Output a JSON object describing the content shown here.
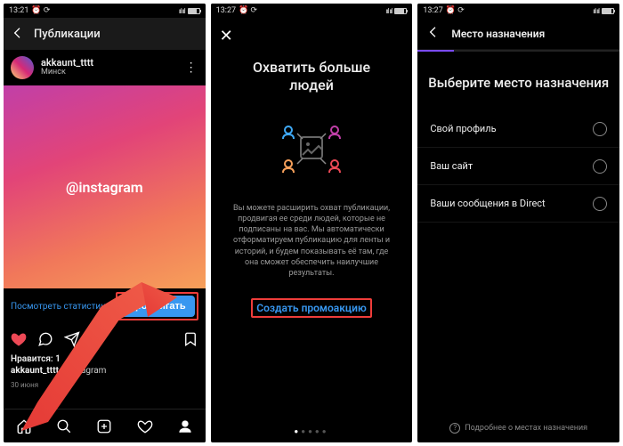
{
  "screen1": {
    "status": {
      "time": "13:21",
      "carrier": "⏰ ⟳",
      "signal": "ııl ııl",
      "batt": "68"
    },
    "header_title": "Публикации",
    "user": {
      "name": "akkaunt_tttt",
      "location": "Минск"
    },
    "image_text": "@instagram",
    "view_stats": "Посмотреть статистику",
    "promote": "Продвигать",
    "likes_line": "Нравится: 1",
    "caption_user": "akkaunt_tttt",
    "caption_hashtag": "#instagram",
    "date": "30 июня"
  },
  "screen2": {
    "status": {
      "time": "13:27",
      "carrier": "⏰ ⟳",
      "signal": "ııl ııl",
      "batt": "68"
    },
    "close": "✕",
    "title_l1": "Охватить больше",
    "title_l2": "людей",
    "desc": "Вы можете расширить охват публикации, продвигая ее среди людей, которые не подписаны на вас. Мы автоматически отформатируем публикацию для ленты и историй, и будем показывать её там, где она сможет обеспечить наилучшие результаты.",
    "cta": "Создать промоакцию"
  },
  "screen3": {
    "status": {
      "time": "13:27",
      "carrier": "⏰ ⟳",
      "signal": "ııl ııl",
      "batt": "68"
    },
    "header_title": "Место назначения",
    "heading": "Выберите место назначения",
    "options": [
      "Свой профиль",
      "Ваш сайт",
      "Ваши сообщения в Direct"
    ],
    "help": "Подробнее о местах назначения"
  }
}
